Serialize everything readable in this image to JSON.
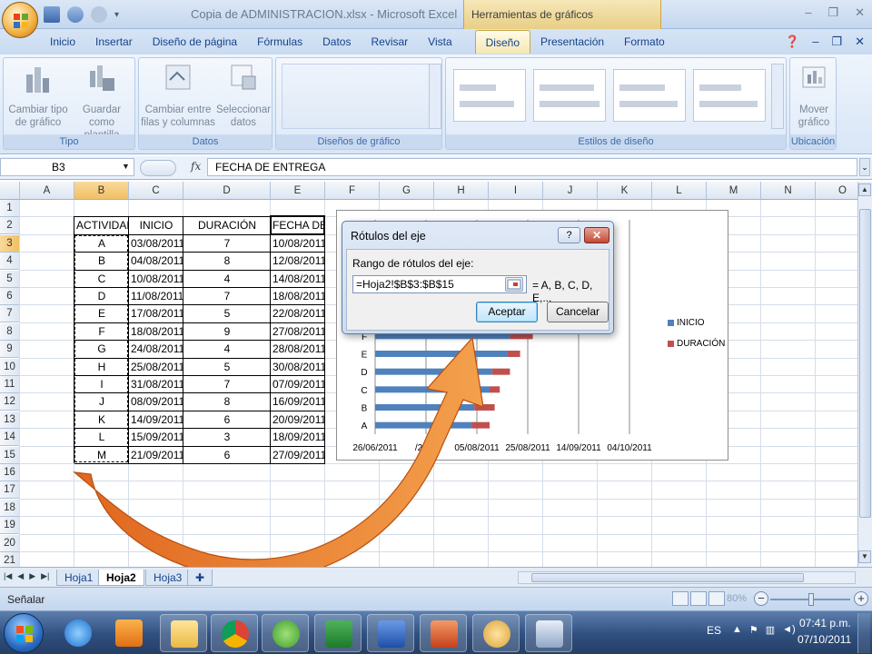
{
  "window": {
    "title": "Copia de ADMINISTRACION.xlsx - Microsoft Excel",
    "contextual_tab_group": "Herramientas de gráficos"
  },
  "ribbon": {
    "tabs": [
      "Inicio",
      "Insertar",
      "Diseño de página",
      "Fórmulas",
      "Datos",
      "Revisar",
      "Vista",
      "Diseño",
      "Presentación",
      "Formato"
    ],
    "active_tab": "Diseño",
    "groups": {
      "tipo": {
        "label": "Tipo",
        "change_type_line1": "Cambiar tipo",
        "change_type_line2": "de gráfico",
        "save_template_line1": "Guardar como",
        "save_template_line2": "plantilla"
      },
      "datos": {
        "label": "Datos",
        "switch_line1": "Cambiar entre",
        "switch_line2": "filas y columnas",
        "select_line1": "Seleccionar",
        "select_line2": "datos"
      },
      "disenos": {
        "label": "Diseños de gráfico"
      },
      "estilos": {
        "label": "Estilos de diseño"
      },
      "ubicacion": {
        "label": "Ubicación",
        "move_line1": "Mover",
        "move_line2": "gráfico"
      }
    }
  },
  "formula_bar": {
    "name_box": "B3",
    "fx": "fx",
    "formula": "FECHA DE ENTREGA"
  },
  "sheet": {
    "columns": [
      "A",
      "B",
      "C",
      "D",
      "E",
      "F",
      "G",
      "H",
      "I",
      "J",
      "K",
      "L",
      "M",
      "N",
      "O"
    ],
    "row_numbers": [
      "1",
      "2",
      "3",
      "4",
      "5",
      "6",
      "7",
      "8",
      "9",
      "10",
      "11",
      "12",
      "13",
      "14",
      "15",
      "16",
      "17",
      "18",
      "19",
      "20",
      "21"
    ],
    "headers": [
      "ACTIVIDAD",
      "INICIO",
      "DURACIÓN",
      "FECHA DE ENTREGA"
    ],
    "rows": [
      [
        "A",
        "03/08/2011",
        "7",
        "10/08/2011"
      ],
      [
        "B",
        "04/08/2011",
        "8",
        "12/08/2011"
      ],
      [
        "C",
        "10/08/2011",
        "4",
        "14/08/2011"
      ],
      [
        "D",
        "11/08/2011",
        "7",
        "18/08/2011"
      ],
      [
        "E",
        "17/08/2011",
        "5",
        "22/08/2011"
      ],
      [
        "F",
        "18/08/2011",
        "9",
        "27/08/2011"
      ],
      [
        "G",
        "24/08/2011",
        "4",
        "28/08/2011"
      ],
      [
        "H",
        "25/08/2011",
        "5",
        "30/08/2011"
      ],
      [
        "I",
        "31/08/2011",
        "7",
        "07/09/2011"
      ],
      [
        "J",
        "08/09/2011",
        "8",
        "16/09/2011"
      ],
      [
        "K",
        "14/09/2011",
        "6",
        "20/09/2011"
      ],
      [
        "L",
        "15/09/2011",
        "3",
        "18/09/2011"
      ],
      [
        "M",
        "21/09/2011",
        "6",
        "27/09/2011"
      ]
    ]
  },
  "chart_data": {
    "type": "bar",
    "orientation": "horizontal",
    "stacked": true,
    "categories": [
      "A",
      "B",
      "C",
      "D",
      "E",
      "F"
    ],
    "series": [
      {
        "name": "INICIO",
        "values": [
          "2011-08-03",
          "2011-08-04",
          "2011-08-10",
          "2011-08-11",
          "2011-08-17",
          "2011-08-18"
        ],
        "color": "#4f81bd"
      },
      {
        "name": "DURACIÓN",
        "values": [
          7,
          8,
          4,
          7,
          5,
          9
        ],
        "color": "#c0504d"
      }
    ],
    "x_tick_labels": [
      "26/06/2011",
      "16/07/2011",
      "05/08/2011",
      "25/08/2011",
      "14/09/2011",
      "04/10/2011"
    ],
    "x_range": [
      "2011-06-26",
      "2011-10-04"
    ],
    "x_tick_visible": [
      "26/06/2011",
      "/2011",
      "05/08/2011",
      "25/08/2011",
      "14/09/2011",
      "04/10/2011"
    ],
    "legend_position": "right",
    "grid": "vertical major gridlines"
  },
  "dialog": {
    "title": "Rótulos del eje",
    "help": "?",
    "close": "✕",
    "range_label": "Rango de rótulos del eje:",
    "range_value": "=Hoja2!$B$3:$B$15",
    "preview": "= A, B, C, D, E,...",
    "accept": "Aceptar",
    "cancel": "Cancelar"
  },
  "sheet_tabs": [
    "Hoja1",
    "Hoja2",
    "Hoja3"
  ],
  "active_sheet": "Hoja2",
  "status": {
    "mode": "Señalar",
    "zoom": "80%"
  },
  "taskbar": {
    "language": "ES",
    "time": "07:41 p.m.",
    "date": "07/10/2011"
  }
}
